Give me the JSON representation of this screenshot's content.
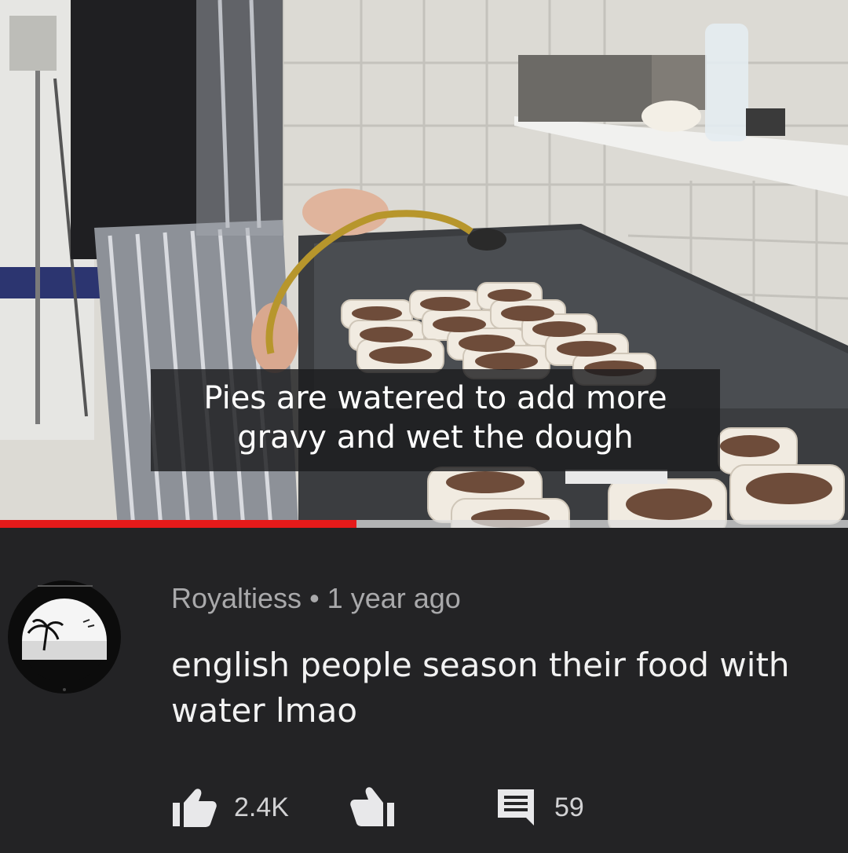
{
  "video": {
    "caption_line1": "Pies are watered to add more",
    "caption_line2": "gravy and wet the dough",
    "progress_fraction": 0.42
  },
  "comment": {
    "author": "Royaltiess",
    "separator": "•",
    "timestamp": "1 year ago",
    "text": "english people season their food with water lmao",
    "likes": "2.4K",
    "replies": "59"
  },
  "icons": {
    "like": "thumbs-up-icon",
    "dislike": "thumbs-down-icon",
    "reply": "comment-icon",
    "avatar": "palm-tree-avatar"
  },
  "colors": {
    "background": "#232325",
    "progress": "#e51a1a",
    "caption_bg": "#1c1c1e",
    "meta_text": "#a9a9ab",
    "comment_text": "#f2f2f2"
  }
}
